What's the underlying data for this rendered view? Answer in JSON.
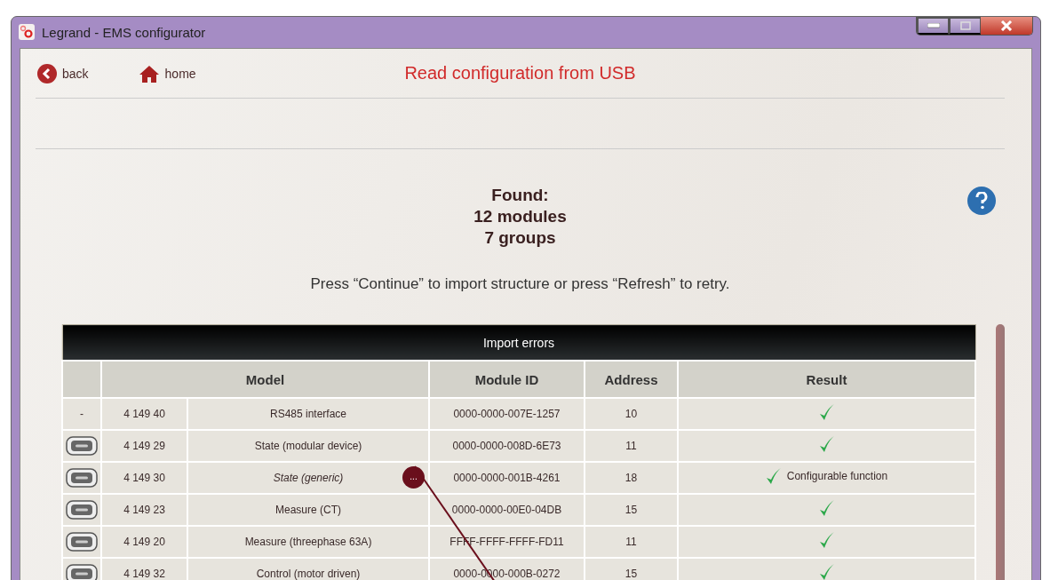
{
  "window": {
    "title": "Legrand - EMS configurator"
  },
  "nav": {
    "back": "back",
    "home": "home",
    "title": "Read configuration from USB"
  },
  "summary": {
    "lines": [
      "Found:",
      "12 modules",
      "7 groups"
    ],
    "instruction": "Press “Continue” to import structure or press “Refresh” to retry."
  },
  "table": {
    "title": "Import errors",
    "columns": [
      "Model",
      "Module ID",
      "Address",
      "Result"
    ],
    "rows": [
      {
        "kind": "dash",
        "marker": "-",
        "code": "4 149 40",
        "name": "RS485 interface",
        "emphasized": false,
        "module_id": "0000-0000-007E-1257",
        "address": "10",
        "ok": true
      },
      {
        "kind": "device",
        "code": "4 149 29",
        "name": "State (modular device)",
        "emphasized": false,
        "module_id": "0000-0000-008D-6E73",
        "address": "11",
        "ok": true
      },
      {
        "kind": "device",
        "code": "4 149 30",
        "name": "State (generic)",
        "emphasized": true,
        "more": "...",
        "module_id": "0000-0000-001B-4261",
        "address": "18",
        "ok": true,
        "note": "Configurable function"
      },
      {
        "kind": "device",
        "code": "4 149 23",
        "name": "Measure (CT)",
        "emphasized": false,
        "module_id": "0000-0000-00E0-04DB",
        "address": "15",
        "ok": true
      },
      {
        "kind": "device",
        "code": "4 149 20",
        "name": "Measure (threephase 63A)",
        "emphasized": false,
        "module_id": "FFFF-FFFF-FFFF-FD11",
        "address": "11",
        "ok": true
      },
      {
        "kind": "device",
        "code": "4 149 32",
        "name": "Control (motor driven)",
        "emphasized": false,
        "module_id": "0000-0000-000B-0272",
        "address": "15",
        "ok": true
      }
    ]
  }
}
